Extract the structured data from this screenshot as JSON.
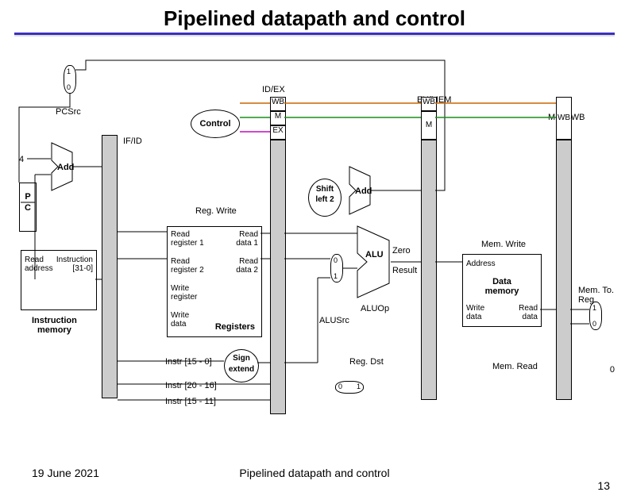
{
  "title": "Pipelined datapath and control",
  "pcsrc": "PCSrc",
  "mux10": {
    "a": "1",
    "b": "0"
  },
  "four": "4",
  "pc_mux": {
    "a": "0",
    "b": "1"
  },
  "stages": {
    "ifid": "IF/ID",
    "idex": "ID/EX",
    "exmem": "EX/MEM",
    "memwb": "MEM/WB"
  },
  "ctrl": "Control",
  "ctrl_sub": {
    "wb": "WB",
    "m": "M",
    "ex": "EX"
  },
  "pc": "P\nC",
  "add1": "Add",
  "add2": "Add",
  "shift": "Shift\nleft 2",
  "regwrite": "Reg. Write",
  "imem": {
    "ra": "Read\naddress",
    "instr": "Instruction\n[31-0]"
  },
  "imem_label": "Instruction\nmemory",
  "regfile": {
    "rr1": "Read\nregister 1",
    "rr2": "Read\nregister 2",
    "wr": "Write\nregister",
    "wd": "Write\ndata",
    "rd1": "Read\ndata 1",
    "rd2": "Read\ndata 2",
    "label": "Registers"
  },
  "signext": "Sign\nextend",
  "instr150": "Instr [15 - 0]",
  "instr2016": "Instr [20 - 16]",
  "instr1511": "Instr [15 - 11]",
  "alu": "ALU",
  "zero": "Zero",
  "result": "Result",
  "aluop": "ALUOp",
  "alusrc": "ALUSrc",
  "regdst": "Reg. Dst",
  "dmem": {
    "addr": "Address",
    "wd": "Write\ndata",
    "rd": "Read\ndata",
    "label": "Data\nmemory"
  },
  "memwrite": "Mem. Write",
  "memread": "Mem. Read",
  "memtoreg": "Mem. To. Reg",
  "mux01": {
    "a": "0",
    "b": "1"
  },
  "muxH01": {
    "a": "0",
    "b": "1"
  },
  "wbmux": {
    "a": "1",
    "b": "0"
  },
  "footer": {
    "date": "19 June 2021",
    "title": "Pipelined datapath and control",
    "page": "13"
  }
}
